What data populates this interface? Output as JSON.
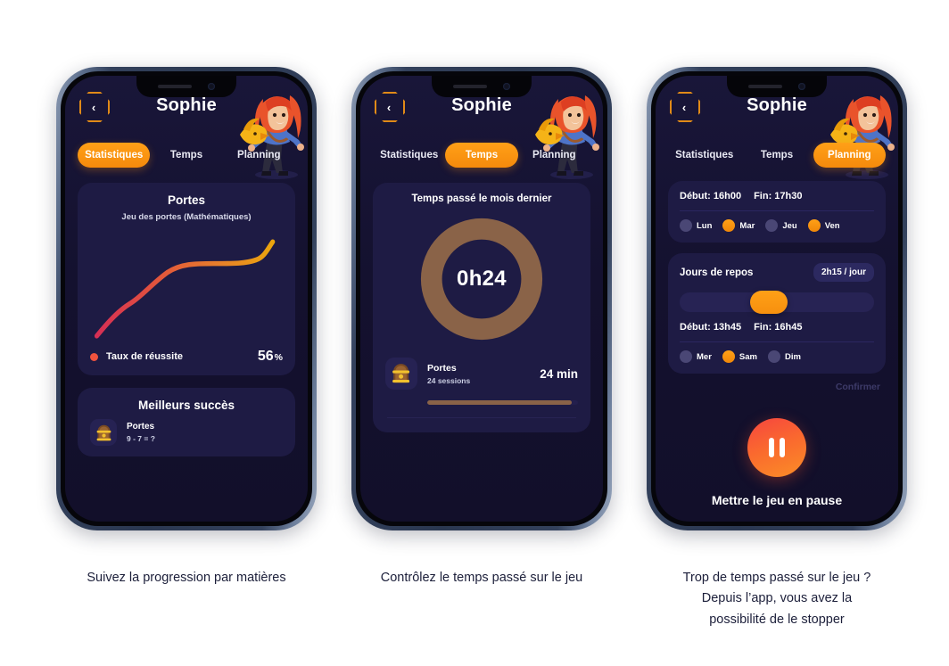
{
  "app": {
    "profile_name": "Sophie",
    "back_icon": "chevron-left-icon",
    "avatar_icon": "character-avatar-red-hair-with-bird",
    "accent_color": "#f99212",
    "card_color": "#1e1b44",
    "screen_color": "#161436"
  },
  "tabs": [
    {
      "id": "statistiques",
      "label": "Statistiques"
    },
    {
      "id": "temps",
      "label": "Temps"
    },
    {
      "id": "planning",
      "label": "Planning"
    }
  ],
  "phone1": {
    "active_tab": "Statistiques",
    "stats_card": {
      "title": "Portes",
      "subtitle": "Jeu des portes (Mathématiques)",
      "legend_label": "Taux de réussite",
      "legend_value": "56",
      "legend_unit": "%",
      "legend_dot_color": "#f0533e"
    },
    "success_card": {
      "title": "Meilleurs succès",
      "items": [
        {
          "icon": "door-game-icon",
          "name": "Portes",
          "detail": "9 - 7 = ?"
        }
      ]
    }
  },
  "phone2": {
    "active_tab": "Temps",
    "time_card": {
      "title": "Temps passé le mois dernier",
      "donut_center": "0h24",
      "donut_color": "#8a6348",
      "session": {
        "icon": "door-game-icon",
        "name": "Portes",
        "sessions": "24 sessions",
        "time": "24 min",
        "progress_percent": 96
      }
    }
  },
  "phone3": {
    "active_tab": "Planning",
    "schedule_card": {
      "start_label": "Début: 16h00",
      "end_label": "Fin: 17h30",
      "days": [
        {
          "label": "Lun",
          "on": false
        },
        {
          "label": "Mar",
          "on": true
        },
        {
          "label": "Jeu",
          "on": false
        },
        {
          "label": "Ven",
          "on": true
        }
      ]
    },
    "rest_card": {
      "title": "Jours de repos",
      "badge": "2h15 / jour",
      "slider_percent": 46,
      "start_label": "Début: 13h45",
      "end_label": "Fin: 16h45",
      "days": [
        {
          "label": "Mer",
          "on": false
        },
        {
          "label": "Sam",
          "on": true
        },
        {
          "label": "Dim",
          "on": false
        }
      ]
    },
    "confirm_label": "Confirmer",
    "pause": {
      "icon": "pause-icon",
      "text": "Mettre le jeu en pause"
    }
  },
  "captions": {
    "one": "Suivez la progression par matières",
    "two": "Contrôlez le temps passé sur le jeu",
    "three_line1": "Trop de temps passé sur le jeu ?",
    "three_line2": "Depuis l’app, vous avez la",
    "three_line3": "possibilité de le stopper"
  },
  "chart_data": {
    "type": "line",
    "title": "Taux de réussite",
    "xlabel": "",
    "ylabel": "Taux de réussite (%)",
    "ylim": [
      0,
      100
    ],
    "grid": false,
    "legend": [
      "Taux de réussite"
    ],
    "final_value": 56,
    "x": [
      0,
      1,
      2,
      3,
      4,
      5,
      6,
      7,
      8,
      9
    ],
    "y": [
      8,
      20,
      30,
      38,
      48,
      55,
      56,
      56,
      57,
      66
    ],
    "gradient_start": "#e0344f",
    "gradient_end": "#e9a00f"
  }
}
